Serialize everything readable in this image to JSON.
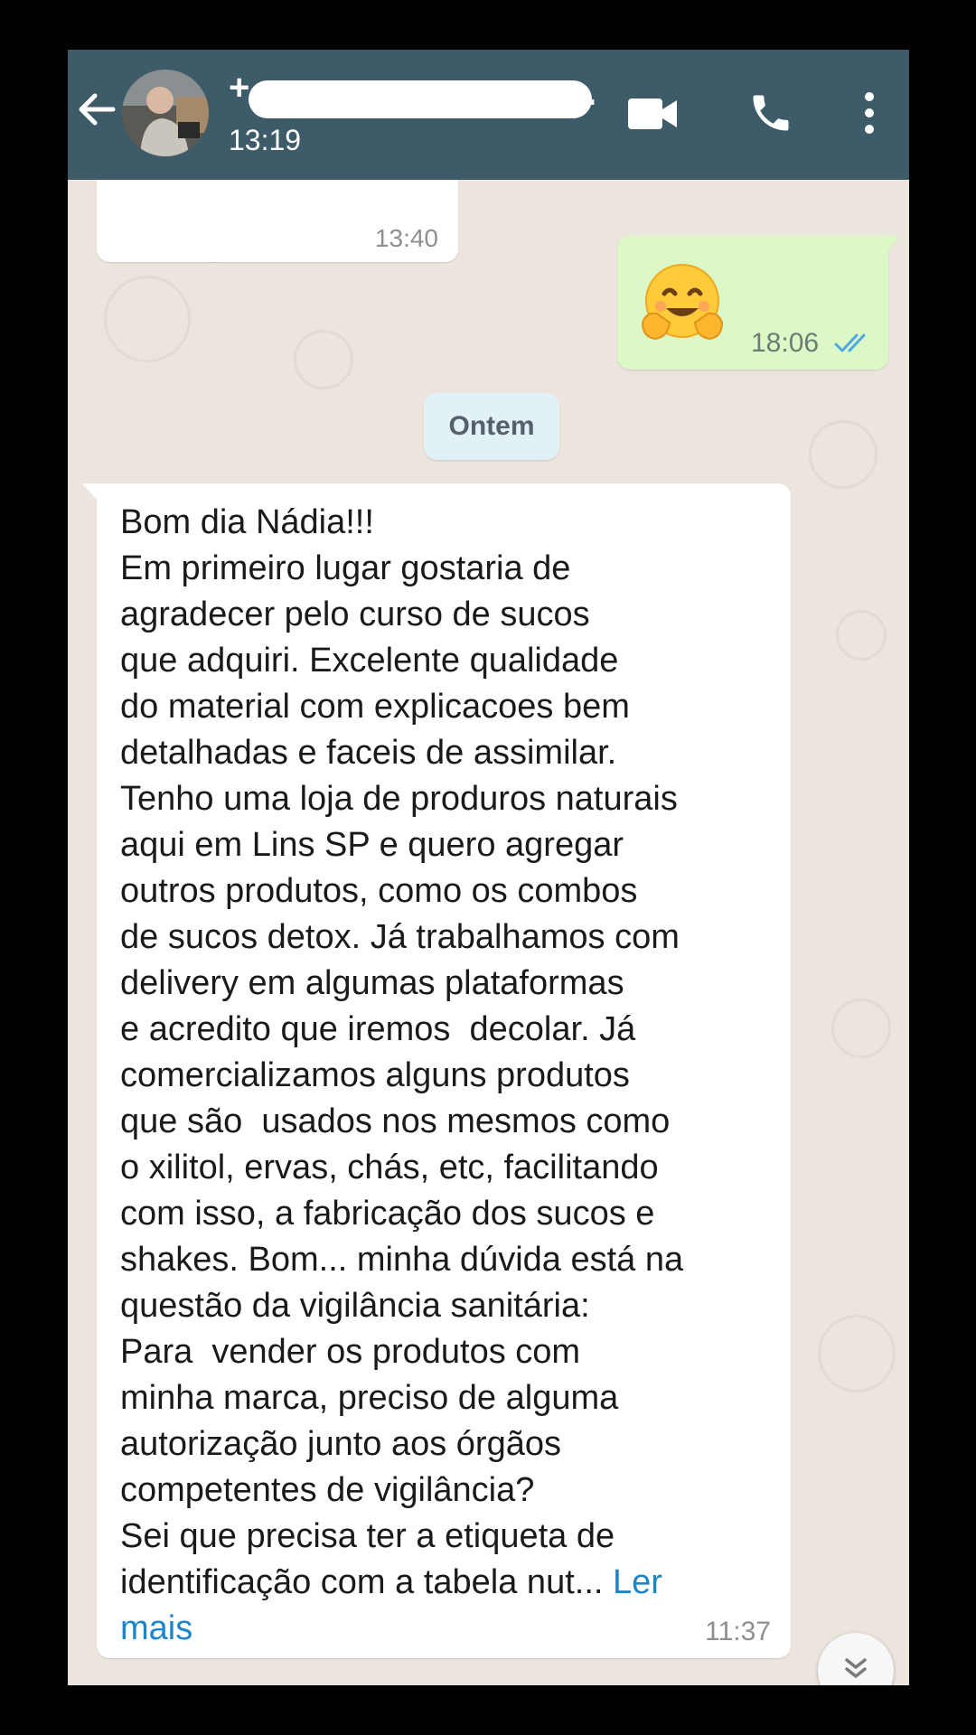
{
  "header": {
    "contact_name": "+",
    "contact_name_suffix": ".",
    "last_seen": "13:19",
    "back_icon": "arrow-left-icon",
    "video_icon": "video-camera-icon",
    "call_icon": "phone-icon",
    "menu_icon": "vertical-dots-icon"
  },
  "messages": {
    "partial": {
      "time": "13:40"
    },
    "outgoing": {
      "emoji": "hugging-face",
      "time": "18:06",
      "status": "read"
    },
    "date_separator": "Ontem",
    "incoming": {
      "text": "Bom dia Nádia!!!\nEm primeiro lugar gostaria de\nagradecer pelo curso de sucos\nque adquiri. Excelente qualidade\ndo material com explicacoes bem\ndetalhadas e faceis de assimilar.\nTenho uma loja de produros naturais\naqui em Lins SP e quero agregar\noutros produtos, como os combos\nde sucos detox. Já trabalhamos com\ndelivery em algumas plataformas\ne acredito que iremos  decolar. Já\ncomercializamos alguns produtos\nque são  usados nos mesmos como\no xilitol, ervas, chás, etc, facilitando\ncom isso, a fabricação dos sucos e\nshakes. Bom... minha dúvida está na\nquestão da vigilância sanitária:\nPara  vender os produtos com\nminha marca, preciso de alguma\nautorização junto aos órgãos\ncompetentes de vigilância?\nSei que precisa ter a etiqueta de\nidentificação com a tabela nut... ",
      "read_more": "Ler\nmais",
      "time": "11:37"
    }
  },
  "colors": {
    "header_bg": "#3e5b6a",
    "chat_bg": "#ece5dd",
    "outgoing_bubble": "#dcf8c6",
    "incoming_bubble": "#ffffff",
    "read_check": "#4fa8e0",
    "link": "#1d86c8"
  },
  "scroll_button_icon": "double-chevron-down-icon"
}
